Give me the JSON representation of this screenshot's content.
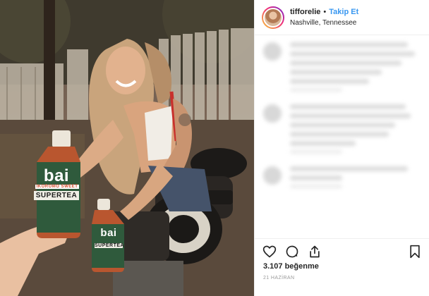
{
  "post": {
    "username": "tifforelie",
    "separator": "•",
    "follow_label": "Takip Et",
    "location": "Nashville, Tennessee",
    "likes_text": "3.107 beğenme",
    "date_text": "21 HAZİRAN"
  },
  "photo": {
    "bottle_big": {
      "brand": "bai",
      "flavor": "IKOROMO SWEET",
      "product": "SUPERTEA"
    },
    "bottle_small": {
      "brand": "bai",
      "product": "SUPERTEA"
    }
  },
  "actions": {
    "icons": [
      "heart-icon",
      "comment-icon",
      "share-icon",
      "bookmark-icon"
    ]
  },
  "colors": {
    "follow_blue": "#3897f0",
    "text": "#262626",
    "muted": "#999999",
    "border": "#efefef"
  }
}
